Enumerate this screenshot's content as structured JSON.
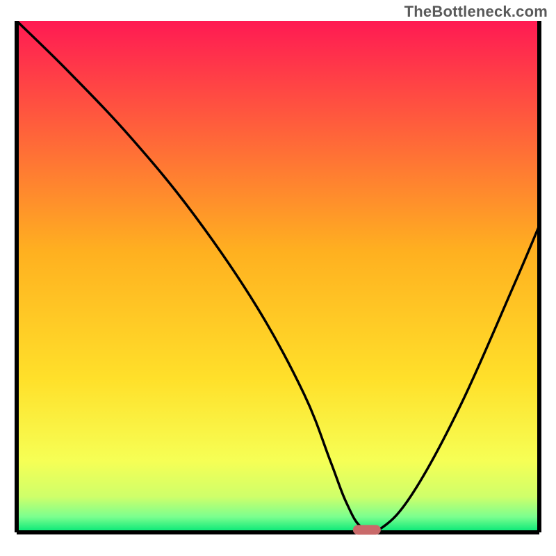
{
  "watermark": "TheBottleneck.com",
  "chart_data": {
    "type": "line",
    "title": "",
    "xlabel": "",
    "ylabel": "",
    "xlim": [
      0,
      100
    ],
    "ylim": [
      0,
      100
    ],
    "axes_visible": false,
    "grid": false,
    "background_gradient_colors": [
      "#ff1a53",
      "#ffd21a",
      "#f6ff55",
      "#00e676"
    ],
    "series": [
      {
        "name": "bottleneck-curve",
        "x": [
          0,
          10,
          22,
          34,
          46,
          55,
          60,
          63,
          66,
          70,
          76,
          85,
          95,
          100
        ],
        "y": [
          100,
          90,
          77,
          62,
          44,
          27,
          14,
          6,
          1,
          1,
          8,
          25,
          48,
          60
        ]
      }
    ],
    "marker": {
      "name": "optimal-point",
      "x": 67,
      "y": 0.5,
      "color": "#c96a6a",
      "shape": "rounded-rect"
    }
  },
  "colors": {
    "axis": "#000000",
    "curve": "#000000",
    "marker": "#c96a6a"
  }
}
